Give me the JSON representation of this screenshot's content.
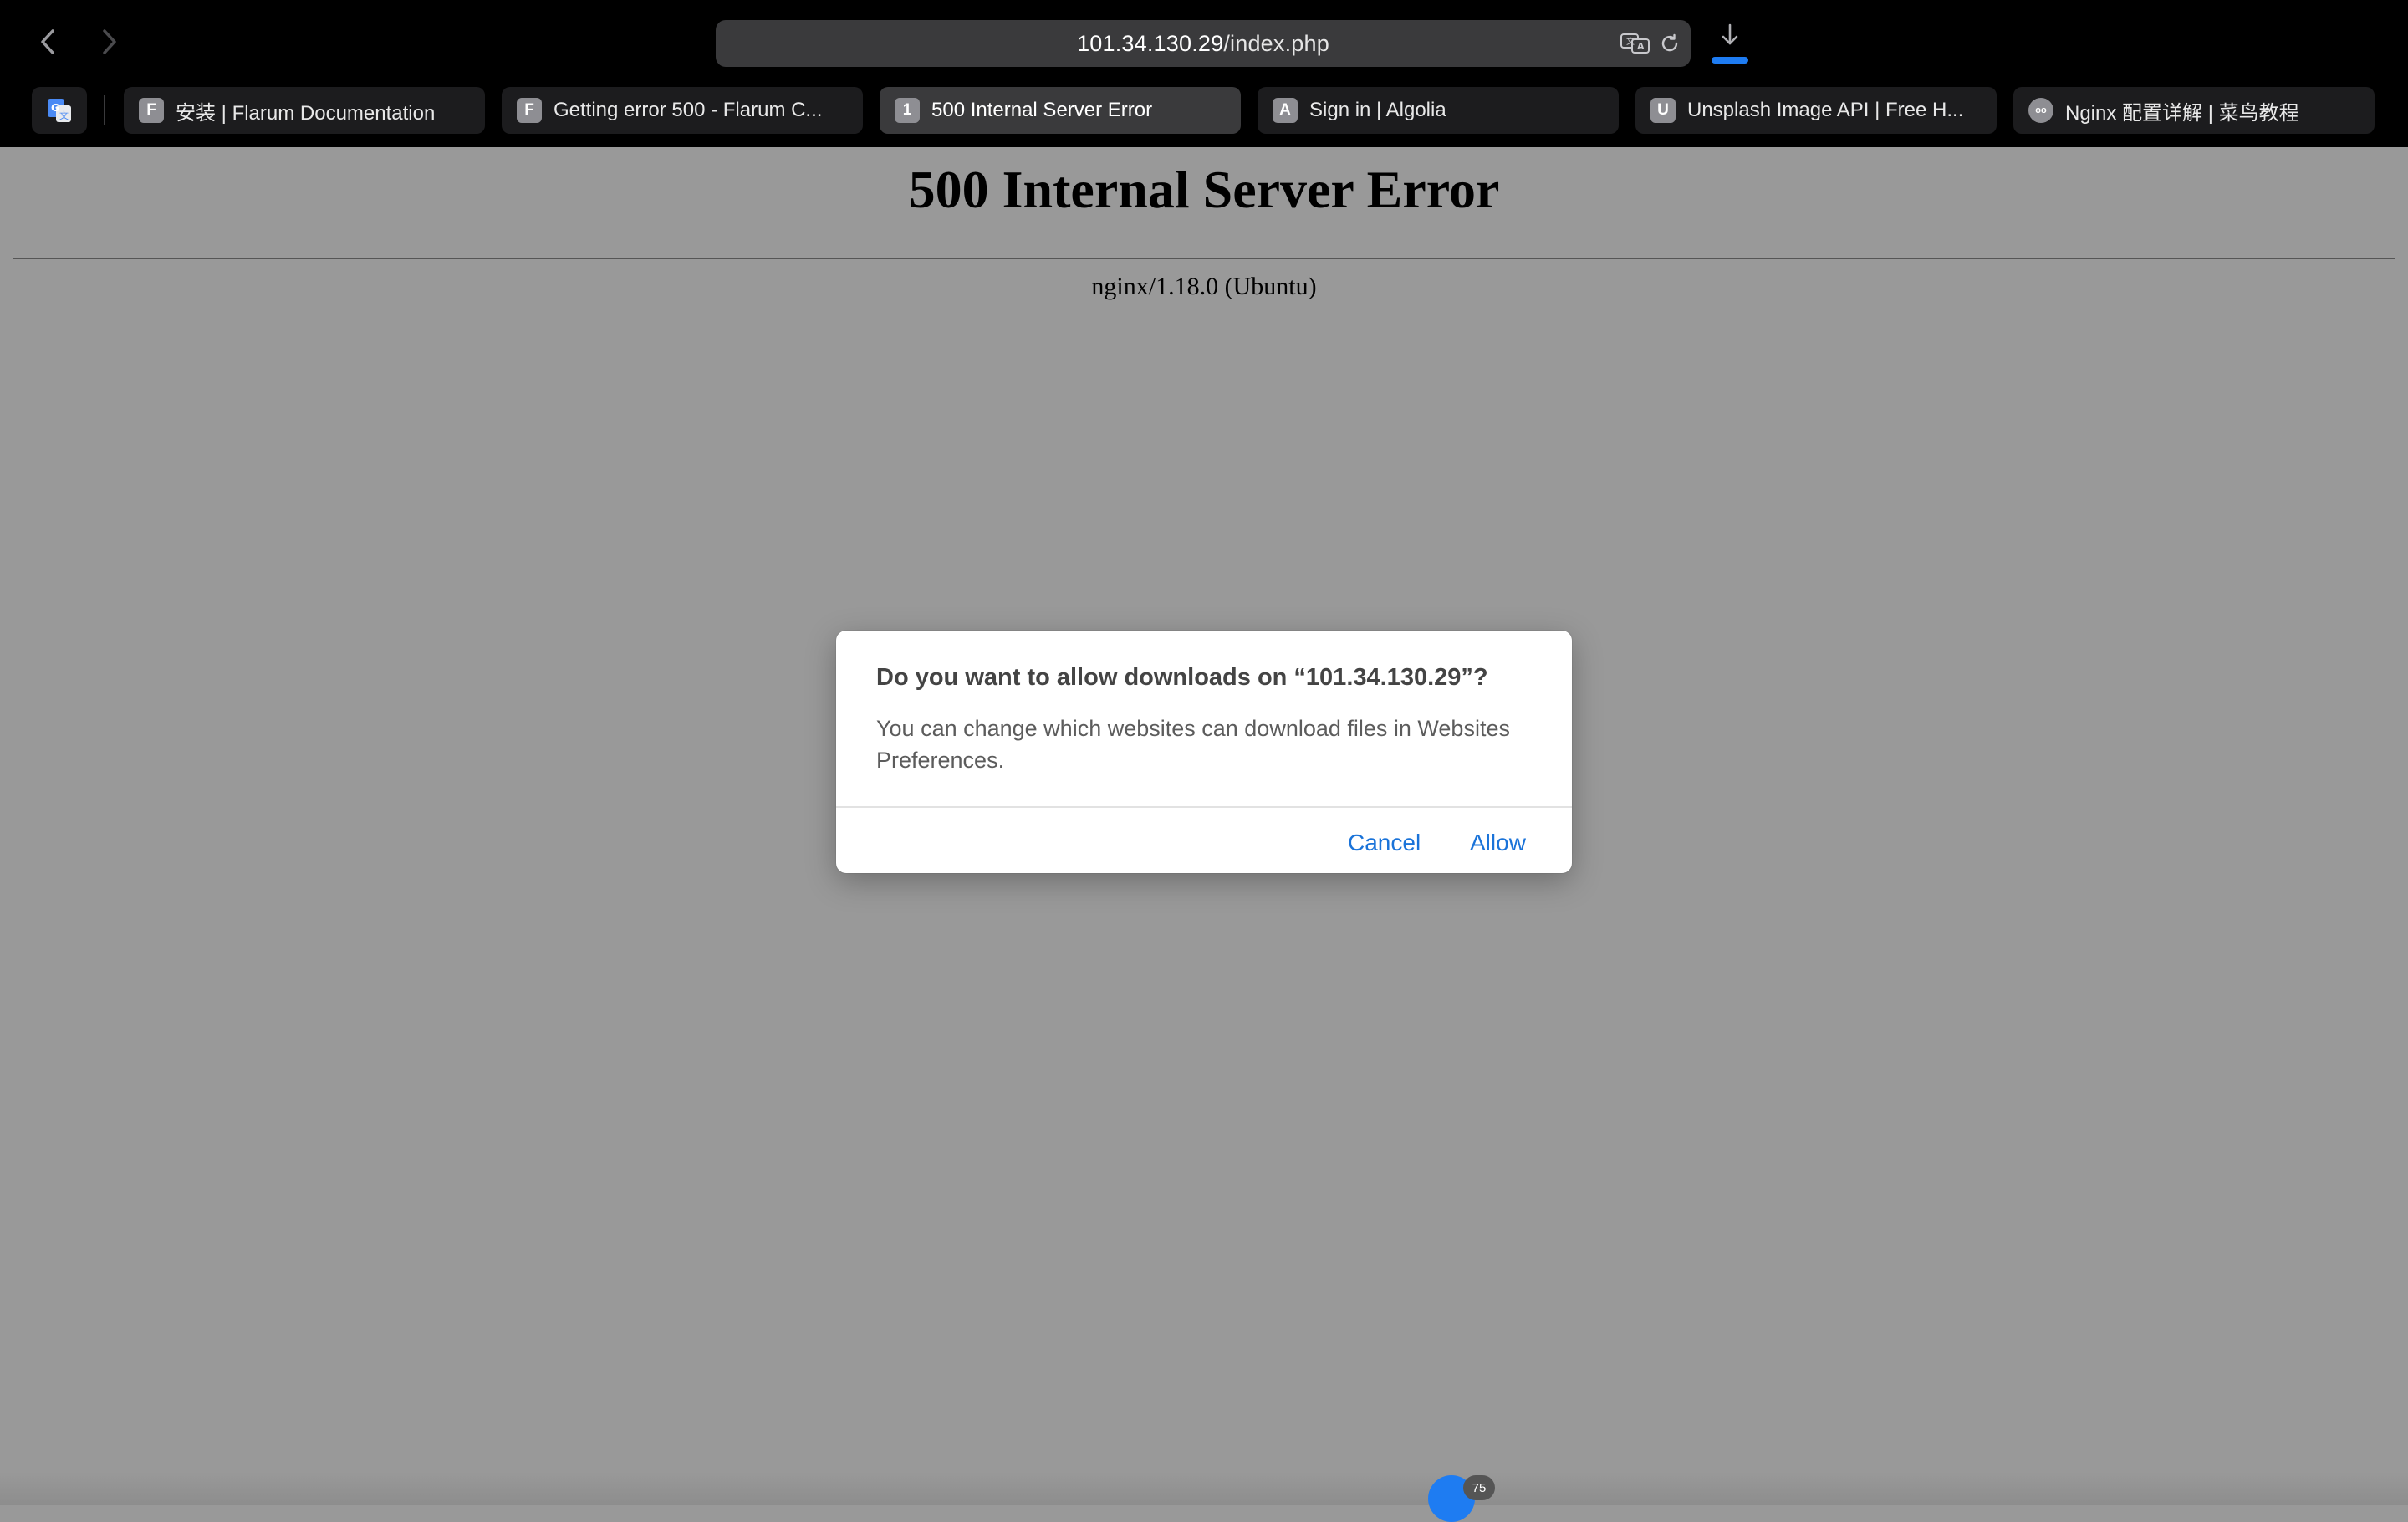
{
  "browser": {
    "address": {
      "host": "101.34.130.29",
      "path": "/index.php"
    },
    "tabs": [
      {
        "favicon": "F",
        "title": "安装 | Flarum Documentation",
        "active": false
      },
      {
        "favicon": "F",
        "title": "Getting error 500 - Flarum C...",
        "active": false
      },
      {
        "favicon": "1",
        "title": "500 Internal Server Error",
        "active": true
      },
      {
        "favicon": "A",
        "title": "Sign in | Algolia",
        "active": false
      },
      {
        "favicon": "U",
        "title": "Unsplash Image API | Free H...",
        "active": false
      },
      {
        "favicon": "oo",
        "title": "Nginx 配置详解 | 菜鸟教程",
        "active": false
      }
    ],
    "download_progress": 1.0
  },
  "page": {
    "heading": "500 Internal Server Error",
    "server_signature": "nginx/1.18.0 (Ubuntu)"
  },
  "dialog": {
    "title": "Do you want to allow downloads on “101.34.130.29”?",
    "message": "You can change which websites can download files in Websites Preferences.",
    "cancel_label": "Cancel",
    "allow_label": "Allow"
  },
  "floating_widget": {
    "badge": "75"
  },
  "colors": {
    "accent": "#1e7cf2",
    "page_background": "#999999",
    "chrome_background": "#000000"
  },
  "icons": {
    "back": "chevron-left-icon",
    "forward": "chevron-right-icon",
    "translate": "translate-icon",
    "reload": "reload-icon",
    "download": "download-icon",
    "extension": "google-translate-icon"
  }
}
